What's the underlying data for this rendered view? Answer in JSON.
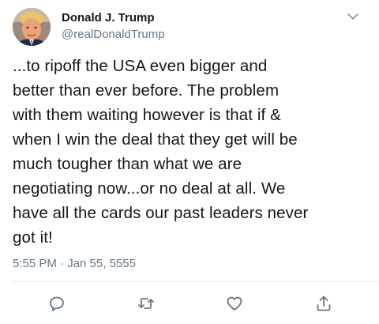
{
  "user": {
    "display_name": "Donald J. Trump",
    "handle": "@realDonaldTrump",
    "avatar_icon": "avatar-photo"
  },
  "tweet": {
    "lines": [
      "...to ripoff the USA even bigger and",
      "better than ever before. The problem",
      "with them waiting however is that if &",
      "when I win the deal that they get will be",
      "much tougher than what we are",
      "negotiating now...or no deal at all. We",
      "have all the cards our past leaders never",
      "got it!"
    ],
    "timestamp": "5:55 PM · Jan 55, 5555"
  },
  "actions": {
    "reply_icon": "reply-icon",
    "retweet_icon": "retweet-icon",
    "like_icon": "heart-icon",
    "share_icon": "share-icon",
    "menu_icon": "chevron-down-icon"
  },
  "colors": {
    "text": "#14171a",
    "secondary": "#657786",
    "icon": "#657786",
    "divider": "#e6ecf0"
  }
}
